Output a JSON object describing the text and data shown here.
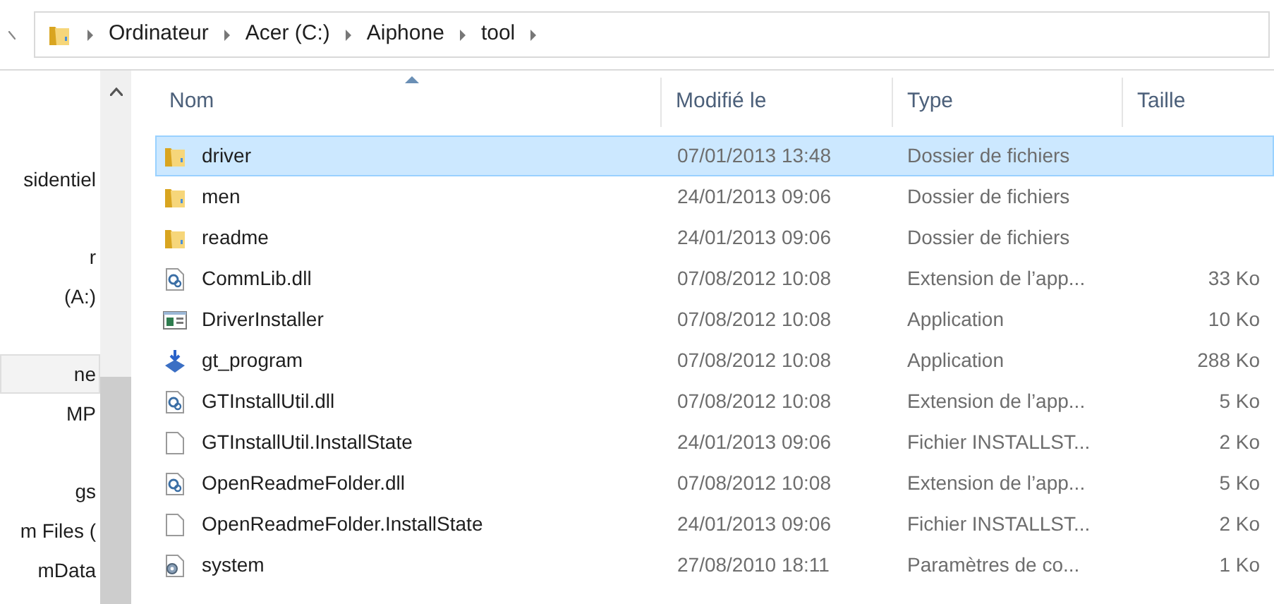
{
  "address_bar": {
    "path": [
      "Ordinateur",
      "Acer (C:)",
      "Aiphone",
      "tool"
    ]
  },
  "nav_pane": {
    "sections": [
      {
        "items": [
          {
            "label": "sidentiel",
            "selected": false
          }
        ]
      },
      {
        "items": [
          {
            "label": "r",
            "selected": false
          },
          {
            "label": "(A:)",
            "selected": false
          }
        ]
      },
      {
        "items": [
          {
            "label": "ne",
            "selected": true
          },
          {
            "label": "MP",
            "selected": false
          }
        ]
      },
      {
        "items": [
          {
            "label": "gs",
            "selected": false
          },
          {
            "label": "m Files (",
            "selected": false
          },
          {
            "label": "mData",
            "selected": false
          }
        ]
      }
    ]
  },
  "table": {
    "columns": [
      "Nom",
      "Modifié le",
      "Type",
      "Taille"
    ],
    "rows": [
      {
        "kind": "folder",
        "name": "driver",
        "modified": "07/01/2013 13:48",
        "type": "Dossier de fichiers",
        "selected": true
      },
      {
        "kind": "folder",
        "name": "men",
        "modified": "24/01/2013 09:06",
        "type": "Dossier de fichiers",
        "selected": false
      },
      {
        "kind": "folder",
        "name": "readme",
        "modified": "24/01/2013 09:06",
        "type": "Dossier de fichiers",
        "selected": false
      },
      {
        "kind": "dll",
        "name": "CommLib.dll",
        "modified": "07/08/2012 10:08",
        "type": "Extension de l’app...",
        "size": "33 Ko",
        "selected": false
      },
      {
        "kind": "app",
        "name": "DriverInstaller",
        "modified": "07/08/2012 10:08",
        "type": "Application",
        "size": "10 Ko",
        "selected": false
      },
      {
        "kind": "installer",
        "name": "gt_program",
        "modified": "07/08/2012 10:08",
        "type": "Application",
        "size": "288 Ko",
        "selected": false
      },
      {
        "kind": "dll",
        "name": "GTInstallUtil.dll",
        "modified": "07/08/2012 10:08",
        "type": "Extension de l’app...",
        "size": "5 Ko",
        "selected": false
      },
      {
        "kind": "file",
        "name": "GTInstallUtil.InstallState",
        "modified": "24/01/2013 09:06",
        "type": "Fichier INSTALLST...",
        "size": "2 Ko",
        "selected": false
      },
      {
        "kind": "dll",
        "name": "OpenReadmeFolder.dll",
        "modified": "07/08/2012 10:08",
        "type": "Extension de l’app...",
        "size": "5 Ko",
        "selected": false
      },
      {
        "kind": "file",
        "name": "OpenReadmeFolder.InstallState",
        "modified": "24/01/2013 09:06",
        "type": "Fichier INSTALLST...",
        "size": "2 Ko",
        "selected": false
      },
      {
        "kind": "config",
        "name": "system",
        "modified": "27/08/2010 18:11",
        "type": "Paramètres de co...",
        "size": "1 Ko",
        "selected": false
      }
    ]
  }
}
